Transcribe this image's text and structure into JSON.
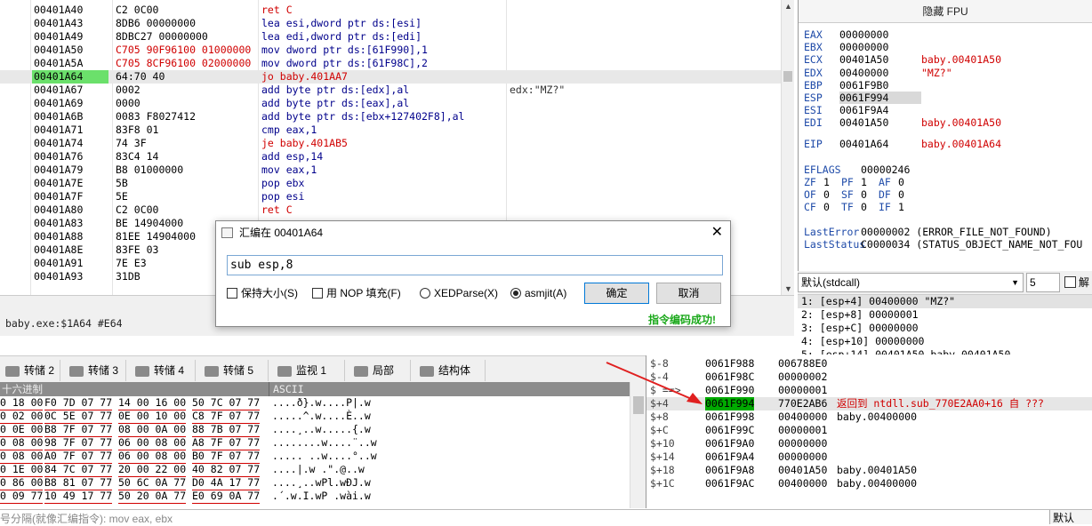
{
  "disasm": {
    "rows": [
      {
        "addr": "00401A40",
        "bytes": "C2 0C00",
        "ins": "ret C",
        "kind": "ret",
        "cmt": ""
      },
      {
        "addr": "00401A43",
        "bytes": "8DB6 00000000",
        "ins": "lea esi,dword ptr ds:[esi]",
        "kind": "",
        "cmt": ""
      },
      {
        "addr": "00401A49",
        "bytes": "8DBC27 00000000",
        "ins": "lea edi,dword ptr ds:[edi]",
        "kind": "",
        "cmt": ""
      },
      {
        "addr": "00401A50",
        "bytes": "C705 90F96100 01000000",
        "ins": "mov dword ptr ds:[61F990],1",
        "kind": "",
        "cmt": "",
        "redbytes": true
      },
      {
        "addr": "00401A5A",
        "bytes": "C705 8CF96100 02000000",
        "ins": "mov dword ptr ds:[61F98C],2",
        "kind": "",
        "cmt": "",
        "redbytes": true
      },
      {
        "addr": "00401A64",
        "bytes": "64:70 40",
        "ins": "jo baby.401AA7",
        "kind": "jump",
        "cmt": "",
        "cur": true
      },
      {
        "addr": "00401A67",
        "bytes": "0002",
        "ins": "add byte ptr ds:[edx],al",
        "kind": "",
        "cmt": "edx:\"MZ?\""
      },
      {
        "addr": "00401A69",
        "bytes": "0000",
        "ins": "add byte ptr ds:[eax],al",
        "kind": "",
        "cmt": ""
      },
      {
        "addr": "00401A6B",
        "bytes": "0083 F8027412",
        "ins": "add byte ptr ds:[ebx+127402F8],al",
        "kind": "",
        "cmt": ""
      },
      {
        "addr": "00401A71",
        "bytes": "83F8 01",
        "ins": "cmp eax,1",
        "kind": "",
        "cmt": ""
      },
      {
        "addr": "00401A74",
        "bytes": "74 3F",
        "ins": "je baby.401AB5",
        "kind": "jump",
        "cmt": ""
      },
      {
        "addr": "00401A76",
        "bytes": "83C4 14",
        "ins": "add esp,14",
        "kind": "",
        "cmt": ""
      },
      {
        "addr": "00401A79",
        "bytes": "B8 01000000",
        "ins": "mov eax,1",
        "kind": "",
        "cmt": ""
      },
      {
        "addr": "00401A7E",
        "bytes": "5B",
        "ins": "pop ebx",
        "kind": "",
        "cmt": ""
      },
      {
        "addr": "00401A7F",
        "bytes": "5E",
        "ins": "pop esi",
        "kind": "",
        "cmt": ""
      },
      {
        "addr": "00401A80",
        "bytes": "C2 0C00",
        "ins": "ret C",
        "kind": "ret",
        "cmt": ""
      },
      {
        "addr": "00401A83",
        "bytes": "BE 14904000",
        "ins": "",
        "kind": "",
        "cmt": ""
      },
      {
        "addr": "00401A88",
        "bytes": "81EE 14904000",
        "ins": "",
        "kind": "",
        "cmt": ""
      },
      {
        "addr": "00401A8E",
        "bytes": "83FE 03",
        "ins": "",
        "kind": "",
        "cmt": ""
      },
      {
        "addr": "00401A91",
        "bytes": "7E E3",
        "ins": "",
        "kind": "",
        "cmt": ""
      },
      {
        "addr": "00401A93",
        "bytes": "31DB",
        "ins": "",
        "kind": "",
        "cmt": ""
      }
    ]
  },
  "infobar": {
    "text": "baby.exe:$1A64 #E64"
  },
  "registers": {
    "header": "隐藏 FPU",
    "gp": [
      {
        "n": "EAX",
        "v": "00000000",
        "s": ""
      },
      {
        "n": "EBX",
        "v": "00000000",
        "s": ""
      },
      {
        "n": "ECX",
        "v": "00401A50",
        "s": "baby.00401A50"
      },
      {
        "n": "EDX",
        "v": "00400000",
        "s": "\"MZ?\""
      },
      {
        "n": "EBP",
        "v": "0061F9B0",
        "s": ""
      },
      {
        "n": "ESP",
        "v": "0061F994",
        "s": ""
      },
      {
        "n": "ESI",
        "v": "0061F9A4",
        "s": ""
      },
      {
        "n": "EDI",
        "v": "00401A50",
        "s": "baby.00401A50"
      }
    ],
    "eip": {
      "n": "EIP",
      "v": "00401A64",
      "s": "baby.00401A64"
    },
    "eflags": {
      "n": "EFLAGS",
      "v": "00000246"
    },
    "flags": [
      [
        "ZF",
        "1",
        "PF",
        "1",
        "AF",
        "0"
      ],
      [
        "OF",
        "0",
        "SF",
        "0",
        "DF",
        "0"
      ],
      [
        "CF",
        "0",
        "TF",
        "0",
        "IF",
        "1"
      ]
    ],
    "last_error": {
      "n": "LastError",
      "v": "00000002 (ERROR_FILE_NOT_FOUND)"
    },
    "last_status": {
      "n": "LastStatus",
      "v": "C0000034 (STATUS_OBJECT_NAME_NOT_FOU"
    }
  },
  "callconv": {
    "selected": "默认(stdcall)",
    "count": "5",
    "unlock_label": "解"
  },
  "stack_args": [
    "1: [esp+4] 00400000 \"MZ?\"",
    "2: [esp+8] 00000001",
    "3: [esp+C] 00000000",
    "4: [esp+10] 00000000",
    "5: [esp+14] 00401A50 baby.00401A50"
  ],
  "tabs": [
    "转储 2",
    "转储 3",
    "转储 4",
    "转储 5",
    "监视 1",
    "局部",
    "结构体"
  ],
  "tab_icons": [
    "dump-icon",
    "dump-icon",
    "dump-icon",
    "dump-icon",
    "watch-icon",
    "locals-icon",
    "struct-icon"
  ],
  "dump": {
    "header_hex": "十六进制",
    "header_ascii": "ASCII",
    "rows": [
      {
        "h": [
          "0 18 00",
          "F0 7D 07 77",
          "14 00 16 00",
          "50 7C 07 77"
        ],
        "a": "....ð}.w....P|.w"
      },
      {
        "h": [
          "0 02 00",
          "0C 5E 07 77",
          "0E 00 10 00",
          "C8 7F 07 77"
        ],
        "a": ".....^.w....È..w"
      },
      {
        "h": [
          "0 0E 00",
          "B8 7F 07 77",
          "08 00 0A 00",
          "88 7B 07 77"
        ],
        "a": "....¸..w.....{.w"
      },
      {
        "h": [
          "0 08 00",
          "98 7F 07 77",
          "06 00 08 00",
          "A8 7F 07 77"
        ],
        "a": "........w....¨..w"
      },
      {
        "h": [
          "0 08 00",
          "A0 7F 07 77",
          "06 00 08 00",
          "B0 7F 07 77"
        ],
        "a": "..... ..w....°..w"
      },
      {
        "h": [
          "0 1E 00",
          "84 7C 07 77",
          "20 00 22 00",
          "40 82 07 77"
        ],
        "a": "....|.w .\".@..w"
      },
      {
        "h": [
          "0 86 00",
          "B8 81 07 77",
          "50 6C 0A 77",
          "D0 4A 17 77"
        ],
        "a": "....¸..wPl.wÐJ.w"
      },
      {
        "h": [
          "0 09 77",
          "10 49 17 77",
          "50 20 0A 77",
          "E0 69 0A 77"
        ],
        "a": ".´.w.I.wP .wài.w"
      }
    ]
  },
  "stack": {
    "rows": [
      {
        "o": "$-8",
        "a": "0061F988",
        "v": "006788E0",
        "m": ""
      },
      {
        "o": "$-4",
        "a": "0061F98C",
        "v": "00000002",
        "m": ""
      },
      {
        "o": "$ ==>",
        "a": "0061F990",
        "v": "00000001",
        "m": ""
      },
      {
        "o": "$+4",
        "a": "0061F994",
        "v": "770E2AB6",
        "m": "返回到 ntdll.sub_770E2AA0+16 自 ???",
        "hl": true
      },
      {
        "o": "$+8",
        "a": "0061F998",
        "v": "00400000",
        "m": "baby.00400000"
      },
      {
        "o": "$+C",
        "a": "0061F99C",
        "v": "00000001",
        "m": ""
      },
      {
        "o": "$+10",
        "a": "0061F9A0",
        "v": "00000000",
        "m": ""
      },
      {
        "o": "$+14",
        "a": "0061F9A4",
        "v": "00000000",
        "m": ""
      },
      {
        "o": "$+18",
        "a": "0061F9A8",
        "v": "00401A50",
        "m": "baby.00401A50"
      },
      {
        "o": "$+1C",
        "a": "0061F9AC",
        "v": "00400000",
        "m": "baby.00400000"
      }
    ]
  },
  "cmdbar": {
    "placeholder": "号分隔(就像汇编指令): mov eax, ebx",
    "right": "默认"
  },
  "dialog": {
    "title": "汇编在 00401A64",
    "input": "sub esp,8",
    "keep_size": "保持大小(S)",
    "nop_fill": "用 NOP 填充(F)",
    "xedparse": "XEDParse(X)",
    "asmjit": "asmjit(A)",
    "ok": "确定",
    "cancel": "取消",
    "status": "指令编码成功!"
  },
  "colors": {
    "accent_red": "#d00000",
    "highlight_green": "#6be06b",
    "success_green": "#1aa81a"
  }
}
